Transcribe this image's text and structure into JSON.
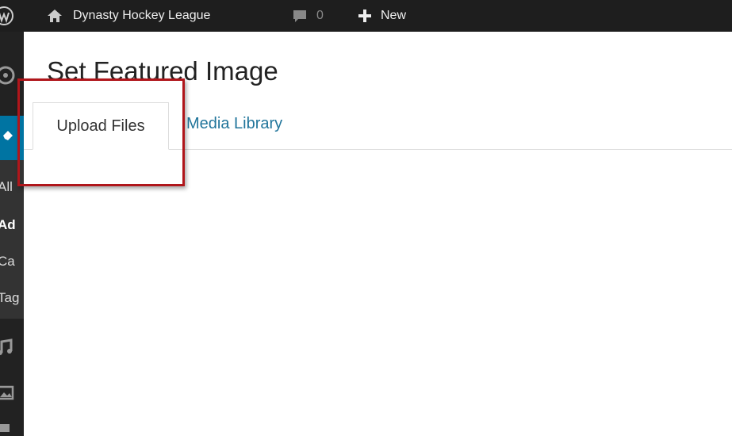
{
  "admin_bar": {
    "wp_logo_icon": "wordpress-logo-icon",
    "site_icon": "home-icon",
    "site_name": "Dynasty Hockey League",
    "comments_icon": "comment-bubble-icon",
    "comments_count": "0",
    "new_icon": "plus-icon",
    "new_label": "New"
  },
  "admin_menu": {
    "icons": [
      "dashboard-icon",
      "pin-icon",
      "music-icon",
      "media-icon"
    ],
    "submenu": [
      "All",
      "Ad",
      "Ca",
      "Tag"
    ]
  },
  "modal": {
    "title": "Set Featured Image",
    "tabs": [
      {
        "label": "Upload Files",
        "active": true
      },
      {
        "label": "Media Library",
        "active": false
      }
    ]
  },
  "colors": {
    "admin_bar_bg": "#1e1e1e",
    "menu_active": "#0074a2",
    "link": "#21759b",
    "highlight": "#b0161b"
  }
}
